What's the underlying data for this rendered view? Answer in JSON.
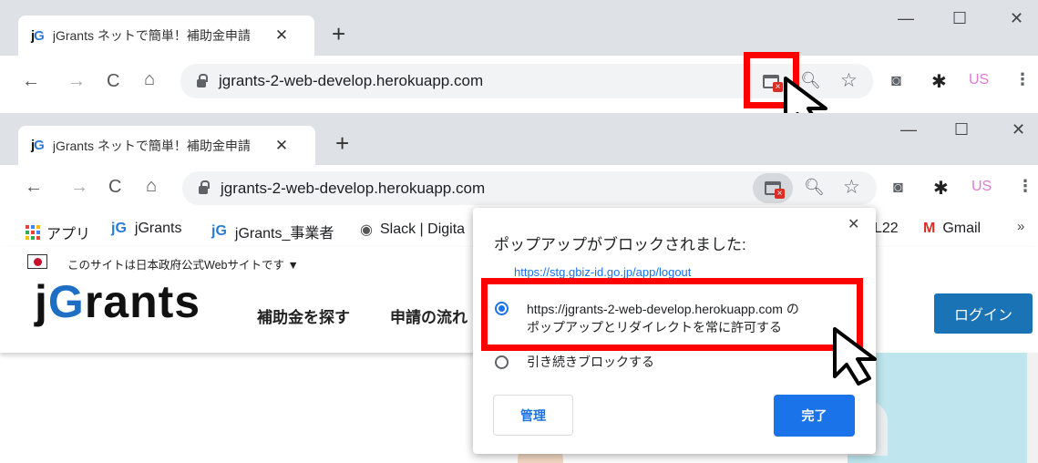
{
  "tab": {
    "logo_j": "j",
    "logo_g": "G",
    "title": "jGrants ネットで簡単！補助金申請",
    "close": "✕",
    "new_tab": "+"
  },
  "window": {
    "minimize": "—",
    "maximize": "☐",
    "close": "✕"
  },
  "nav": {
    "back": "←",
    "forward": "→",
    "reload": "C",
    "home": "⌂"
  },
  "omnibox": {
    "url": "jgrants-2-web-develop.herokuapp.com"
  },
  "toolbar": {
    "zoom": "🔍︎",
    "star": "☆",
    "camera": "◙",
    "extensions": "✱",
    "profile": "US",
    "menu": "⋮"
  },
  "bookmarks": {
    "apps": "アプリ",
    "items": [
      {
        "icon": "jG",
        "label": "jGrants"
      },
      {
        "icon": "jG",
        "label": "jGrants_事業者"
      },
      {
        "icon": "◉",
        "label": "Slack | Digita"
      },
      {
        "icon": "",
        "label": "L22"
      },
      {
        "icon": "M",
        "label": "Gmail"
      }
    ],
    "more": "»"
  },
  "site": {
    "notice": "このサイトは日本政府公式Webサイトです ▼",
    "brand_j": "j",
    "brand_g": "G",
    "brand_rest": "rants",
    "nav_items": [
      "補助金を探す",
      "申請の流れ"
    ],
    "login": "ログイン"
  },
  "dialog": {
    "title": "ポップアップがブロックされました:",
    "close": "✕",
    "blocked_link": "https://stg.gbiz-id.go.jp/app/logout",
    "option_allow_line1": "https://jgrants-2-web-develop.herokuapp.com の",
    "option_allow_line2": "ポップアップとリダイレクトを常に許可する",
    "option_block": "引き続きブロックする",
    "manage_label": "管理",
    "done_label": "完了"
  },
  "colors": {
    "highlight": "#ff0000",
    "accent": "#1a73e8",
    "brand_blue": "#1d6ec4"
  }
}
